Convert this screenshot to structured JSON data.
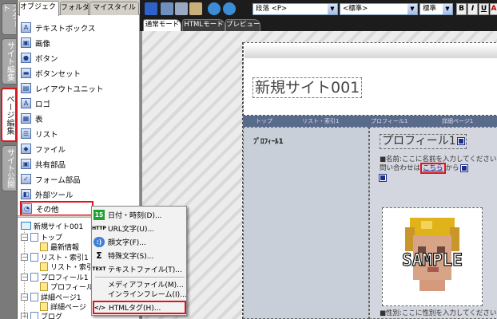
{
  "vertical_tabs": [
    {
      "label": "スタート"
    },
    {
      "label": "サイト編集"
    },
    {
      "label": "ページ編集"
    },
    {
      "label": "サイト公開"
    }
  ],
  "panel": {
    "tabs": [
      {
        "label": "オブジェクト"
      },
      {
        "label": "フォルダ"
      },
      {
        "label": "マイスタイル"
      }
    ],
    "objects": [
      {
        "label": "テキストボックス",
        "icon": "text-box-icon"
      },
      {
        "label": "画像",
        "icon": "image-icon"
      },
      {
        "label": "ボタン",
        "icon": "button-icon"
      },
      {
        "label": "ボタンセット",
        "icon": "button-set-icon"
      },
      {
        "label": "レイアウトユニット",
        "icon": "layout-unit-icon"
      },
      {
        "label": "ロゴ",
        "icon": "logo-icon"
      },
      {
        "label": "表",
        "icon": "table-icon"
      },
      {
        "label": "リスト",
        "icon": "list-icon"
      },
      {
        "label": "ファイル",
        "icon": "file-icon"
      },
      {
        "label": "共有部品",
        "icon": "shared-parts-icon"
      },
      {
        "label": "フォーム部品",
        "icon": "form-parts-icon"
      },
      {
        "label": "外部ツール",
        "icon": "external-tool-icon"
      },
      {
        "label": "その他",
        "icon": "other-icon"
      }
    ],
    "tree": [
      {
        "label": "新規サイト001",
        "exp": ""
      },
      {
        "label": "トップ",
        "exp": "－"
      },
      {
        "label": "最新情報",
        "exp": ""
      },
      {
        "label": "リスト・索引1",
        "exp": "－"
      },
      {
        "label": "リスト・索引",
        "exp": ""
      },
      {
        "label": "プロフィール1",
        "exp": "－"
      },
      {
        "label": "プロフィール",
        "exp": ""
      },
      {
        "label": "詳細ページ1",
        "exp": "－"
      },
      {
        "label": "詳細ページ",
        "exp": ""
      },
      {
        "label": "ブログ",
        "exp": "＋"
      }
    ]
  },
  "toolbar": {
    "paragraph": "段落 <P>",
    "font": "<標準>",
    "size": "標準",
    "bold": "B",
    "italic": "I",
    "underline": "U",
    "font_color": "A"
  },
  "mode_tabs": [
    {
      "label": "通常モード"
    },
    {
      "label": "HTMLモード"
    },
    {
      "label": "プレビュー"
    }
  ],
  "page": {
    "site_title": "新規サイト001",
    "nav_items": [
      "トップ",
      "リスト・索引1",
      "プロフィール1",
      "詳細ページ1"
    ],
    "left_title": "ﾌﾟﾛﾌｨｰﾙ1",
    "profile_title": "プロフィール1",
    "name_line": "■名前:ここに名前を入力してください",
    "inquiry_prefix": "問い合わせは",
    "inquiry_link": "こちら",
    "inquiry_suffix": "から",
    "image_text": "SAMPLE",
    "gender_line": "■性別:ここに性別を入力してください"
  },
  "context_menu": [
    {
      "label": "日付・時刻(D)...",
      "icon": "calendar-icon",
      "glyph": "15"
    },
    {
      "label": "URL文字(U)...",
      "icon": "url-text-icon",
      "glyph": "HTTP"
    },
    {
      "label": "顔文字(F)...",
      "icon": "emoticon-icon",
      "glyph": ":)"
    },
    {
      "label": "特殊文字(S)...",
      "icon": "special-char-icon",
      "glyph": "Σ"
    },
    {
      "label": "テキストファイル(T)...",
      "icon": "text-file-icon",
      "glyph": "TEXT"
    },
    {
      "label": "メディアファイル(M)...",
      "icon": "",
      "glyph": ""
    },
    {
      "label": "インラインフレーム(I)...",
      "icon": "",
      "glyph": ""
    },
    {
      "label": "HTMLタグ(H)...",
      "icon": "html-tag-icon",
      "glyph": "</>"
    }
  ],
  "colors": {
    "highlight": "#e0141c",
    "toolbar_bg": "#1c1c1c",
    "nav_bar": "#596b8a"
  }
}
